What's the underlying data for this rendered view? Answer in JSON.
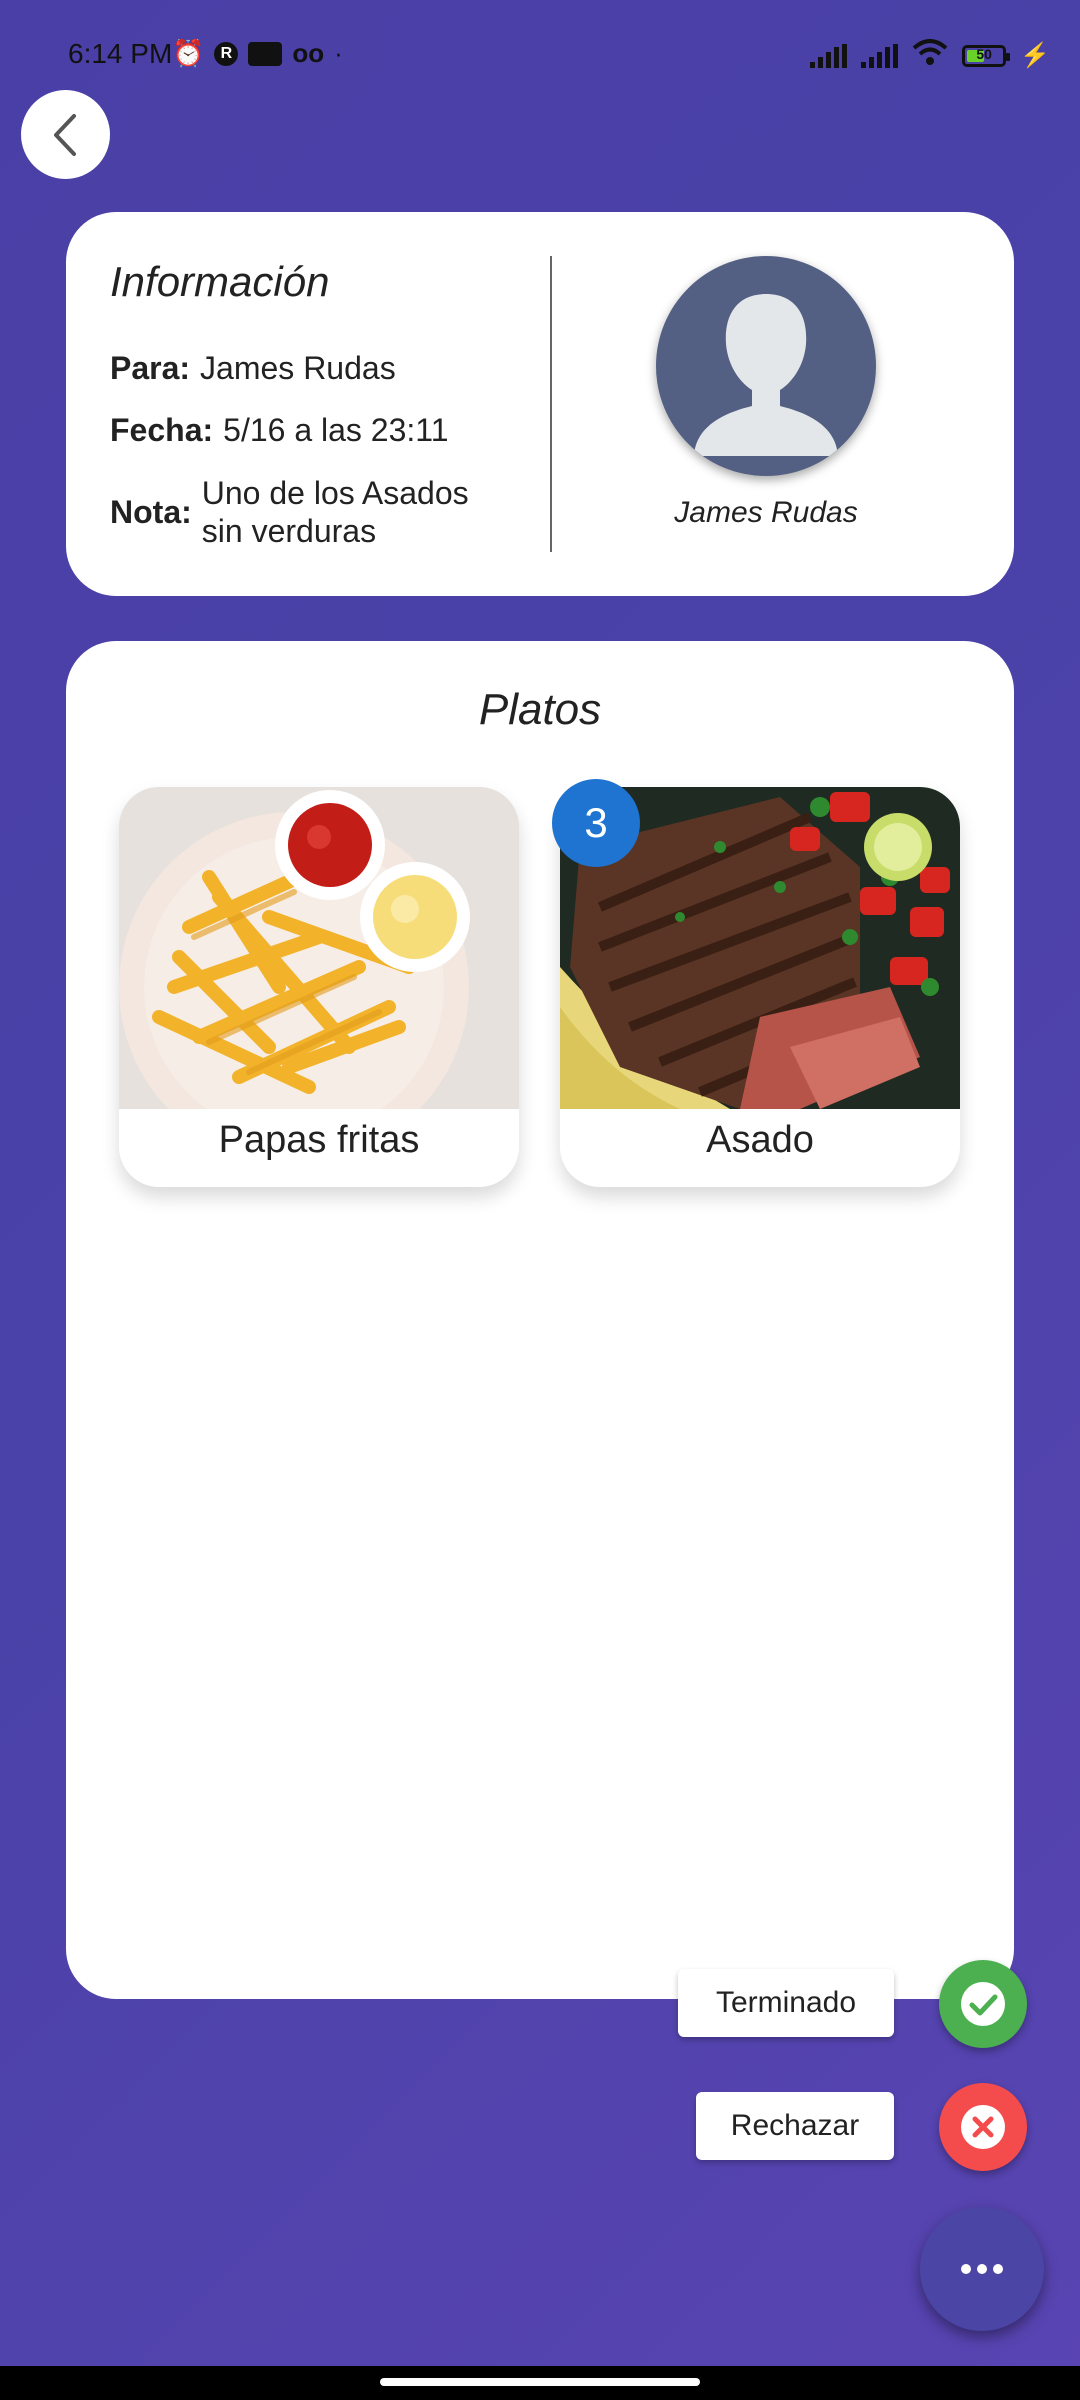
{
  "status_bar": {
    "time": "6:14 PM",
    "battery": "50",
    "battery_level": 0.5,
    "icons_left": [
      "alarm-icon",
      "r-app-icon",
      "messages-icon",
      "voicemail-icon"
    ],
    "icons_right": [
      "signal-icon",
      "signal-icon",
      "wifi-icon",
      "battery-icon",
      "charging-icon"
    ]
  },
  "info": {
    "title": "Información",
    "para_label": "Para:",
    "para_value": "James Rudas",
    "fecha_label": "Fecha:",
    "fecha_value": "5/16 a las 23:11",
    "nota_label": "Nota:",
    "nota_line1": "Uno de los Asados",
    "nota_line2": "sin verduras",
    "avatar_name": "James Rudas"
  },
  "dishes": {
    "title": "Platos",
    "items": [
      {
        "name": "Papas fritas",
        "badge": ""
      },
      {
        "name": "Asado",
        "badge": "3"
      }
    ]
  },
  "actions": {
    "terminado_label": "Terminado",
    "rechazar_label": "Rechazar"
  },
  "colors": {
    "background": "#4a42a8",
    "badge": "#1e74d0",
    "success": "#4caf50",
    "danger": "#f44c4c",
    "main_fab": "#4b46a5"
  }
}
